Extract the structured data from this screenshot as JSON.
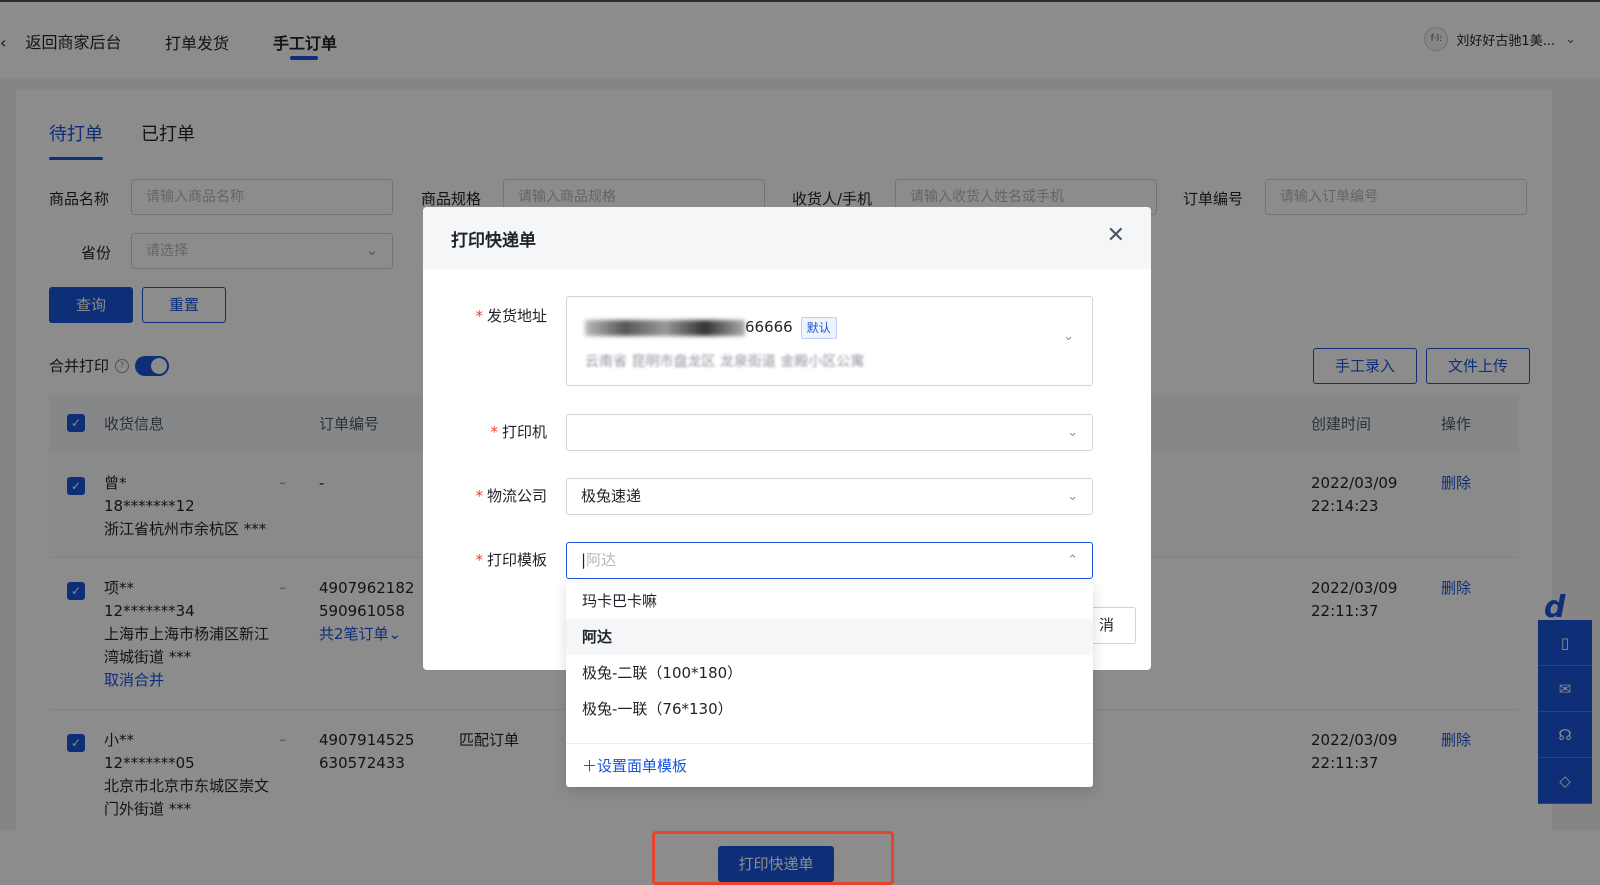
{
  "topbar": {
    "back_icon": "chevron-left-icon",
    "back_label": "返回商家后台",
    "nav": [
      "打单发货",
      "手工订单"
    ],
    "user_name": "刘好好古驰1美...",
    "avatar_text": "f·l:"
  },
  "tabs": [
    "待打单",
    "已打单"
  ],
  "filters": {
    "product_name": {
      "label": "商品名称",
      "placeholder": "请输入商品名称"
    },
    "product_spec": {
      "label": "商品规格",
      "placeholder": "请输入商品规格"
    },
    "receiver": {
      "label": "收货人/手机",
      "placeholder": "请输入收货人姓名或手机"
    },
    "order_no": {
      "label": "订单编号",
      "placeholder": "请输入订单编号"
    },
    "province": {
      "label": "省份",
      "placeholder": "请选择"
    }
  },
  "buttons": {
    "query": "查询",
    "reset": "重置",
    "manual_entry": "手工录入",
    "file_upload": "文件上传"
  },
  "merge_print": {
    "label": "合并打印",
    "enabled": true
  },
  "table": {
    "headers": {
      "receiver": "收货信息",
      "order_no": "订单编号",
      "created": "创建时间",
      "actions": "操作"
    },
    "rows": [
      {
        "name": "曾*",
        "phone": "18*******12",
        "address": "浙江省杭州市余杭区 ***",
        "address2": "",
        "order_no1": "-",
        "order_no2": "",
        "status": "",
        "merge_link": "",
        "cancel_merge": "",
        "date": "2022/03/09",
        "time": "22:14:23",
        "action": "删除"
      },
      {
        "name": "项**",
        "phone": "12*******34",
        "address": "上海市上海市杨浦区新江",
        "address2": "湾城街道 ***",
        "order_no1": "4907962182",
        "order_no2": "590961058",
        "status": "",
        "merge_link": "共2笔订单",
        "cancel_merge": "取消合并",
        "date": "2022/03/09",
        "time": "22:11:37",
        "action": "删除"
      },
      {
        "name": "小**",
        "phone": "12*******05",
        "address": "北京市北京市东城区崇文",
        "address2": "门外街道 ***",
        "order_no1": "4907914525",
        "order_no2": "630572433",
        "status": "匹配订单",
        "merge_link": "",
        "cancel_merge": "",
        "date": "2022/03/09",
        "time": "22:11:37",
        "action": "删除"
      }
    ]
  },
  "bottom": {
    "print_button": "打印快递单"
  },
  "side_float": {
    "logo": "d",
    "icons": [
      "book-icon",
      "mail-icon",
      "headset-icon",
      "shield-icon"
    ]
  },
  "modal": {
    "title": "打印快递单",
    "fields": {
      "ship_address": {
        "label": "发货地址",
        "line1_suffix": "66666",
        "tag": "默认",
        "line2": "云南省 昆明市盘龙区 龙泉街道 金殿小区公寓"
      },
      "printer": {
        "label": "打印机",
        "value": ""
      },
      "logistics": {
        "label": "物流公司",
        "value": "极兔速递"
      },
      "template": {
        "label": "打印模板",
        "placeholder": "阿达"
      }
    },
    "cancel_peek": "消"
  },
  "dropdown": {
    "options": [
      "玛卡巴卡嘛",
      "阿达",
      "极兔-二联（100*180）",
      "极兔-一联（76*130）"
    ],
    "selected_index": 1,
    "footer": "＋设置面单模板"
  }
}
